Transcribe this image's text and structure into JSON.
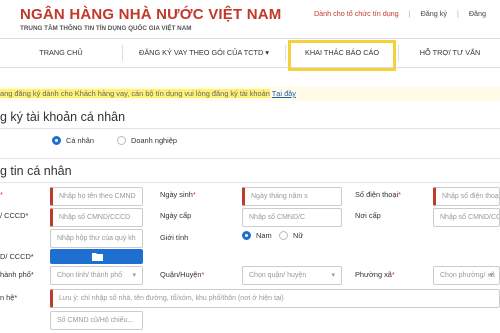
{
  "header": {
    "title": "NGÂN HÀNG NHÀ NƯỚC VIỆT NAM",
    "subtitle": "TRUNG TÂM THÔNG TIN TÍN DỤNG QUỐC GIA VIỆT NAM",
    "links": {
      "credit_orgs": "Dành cho tổ chức tín dụng",
      "register": "Đăng ký",
      "login": "Đăng"
    }
  },
  "nav": {
    "home": "TRANG CHỦ",
    "register_loan": "ĐĂNG KÝ VAY THEO GÓI CỦA TCTD ▾",
    "reports": "KHAI THÁC BÁO CÁO",
    "support": "HỖ TRỢ/ TƯ VẤN"
  },
  "banner": {
    "text": "ang đăng ký dành cho Khách hàng vay, cán bộ tín dụng vui lòng đăng ký tài khoản",
    "link": "Tại đây"
  },
  "account_section": {
    "title": "g ký tài khoản cá nhân",
    "options": [
      "Cá nhân",
      "Doanh nghiệp"
    ],
    "selected": "Cá nhân"
  },
  "info_section": {
    "title": "g tin cá nhân",
    "labels": {
      "name": "*",
      "id": "/ CCCD*",
      "id_image": "D/ CCCD*",
      "province": "hành phố*",
      "address": "n hệ*",
      "dob": "Ngày sinh*",
      "issue_date": "Ngày cấp",
      "gender": "Giới tính",
      "district": "Quận/Huyện*",
      "phone": "Số điện thoại*",
      "issue_place": "Nơi cấp",
      "ward": "Phường xã*"
    },
    "placeholders": {
      "name": "Nhập họ tên theo CMND",
      "id": "Nhập số CMND/CCCD",
      "email": "Nhập hộp thư của quý kh",
      "province": "Chọn tỉnh/ thành phố",
      "address": "Lưu ý: chỉ nhập số nhà, tên đường, tổ/xóm, khu phố/thôn (nơi ở hiện tại)",
      "old_id": "Số CMND cũ/Hộ chiếu...",
      "dob": "Ngày tháng năm s",
      "issue_date": "Nhập số CMND/C",
      "district": "Chọn quận/ huyện",
      "phone": "Nhập số điện thoại",
      "issue_place": "Nhập số CMND/CC",
      "ward": "Chọn phường/ xã"
    },
    "gender_options": [
      "Nam",
      "Nữ"
    ],
    "gender_selected": "Nam"
  },
  "colors": {
    "brand_red": "#c0392b",
    "accent_blue": "#1f6fd1",
    "highlight_yellow": "#f2d13c"
  }
}
